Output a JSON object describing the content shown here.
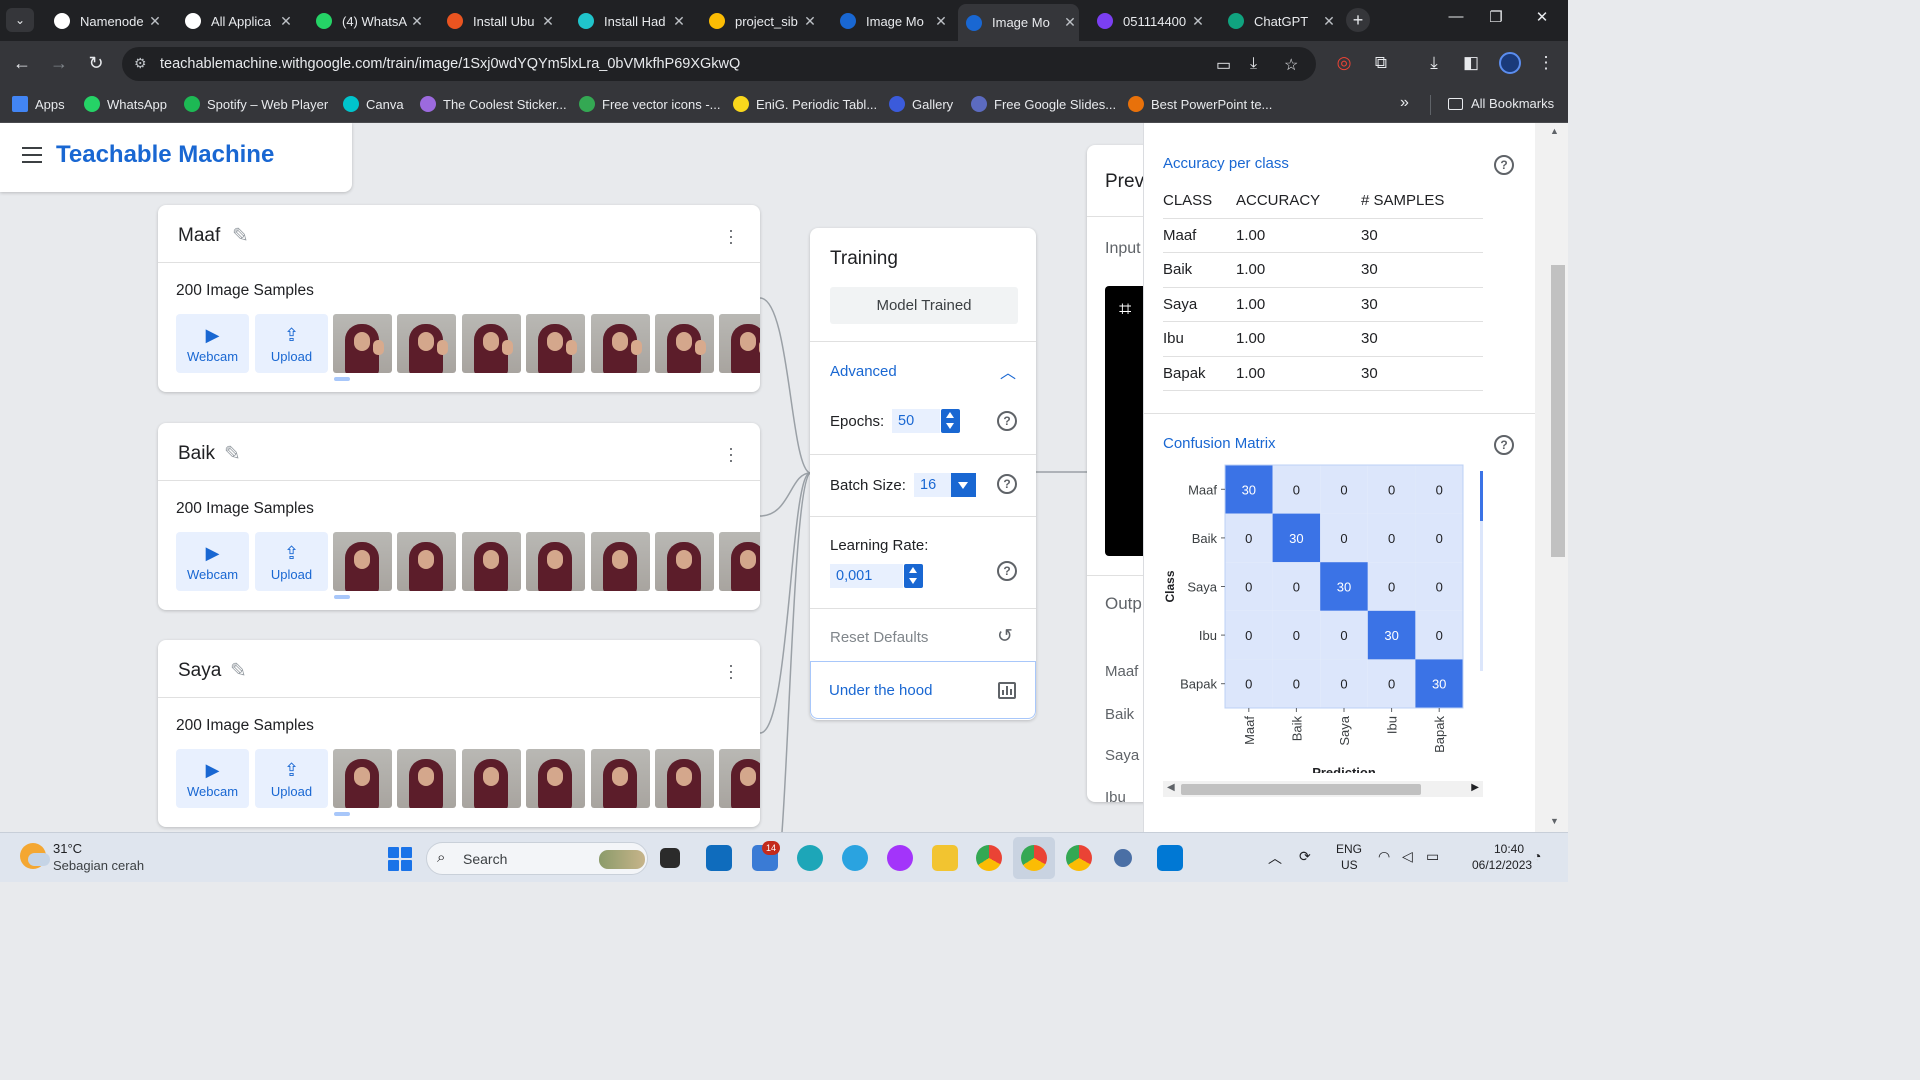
{
  "browser": {
    "tabs": [
      {
        "title": "Namenode",
        "favicon_color": "#ffffff",
        "favicon": "globe-icon"
      },
      {
        "title": "All Applica",
        "favicon_color": "#ffffff",
        "favicon": "globe-icon"
      },
      {
        "title": "(4) WhatsA",
        "favicon_color": "#25d366",
        "favicon": "whatsapp-icon"
      },
      {
        "title": "Install Ubu",
        "favicon_color": "#e95420",
        "favicon": "ubuntu-icon"
      },
      {
        "title": "Install Had",
        "favicon_color": "#20c4cb",
        "favicon": "k-icon"
      },
      {
        "title": "project_sib",
        "favicon_color": "#fbbc04",
        "favicon": "drive-icon"
      },
      {
        "title": "Image Mo",
        "favicon_color": "#1967d2",
        "favicon": "tm-icon"
      },
      {
        "title": "Image Mo",
        "favicon_color": "#1967d2",
        "favicon": "tm-icon",
        "active": true
      },
      {
        "title": "051114400",
        "favicon_color": "#7b3ff2",
        "favicon": "app-icon"
      },
      {
        "title": "ChatGPT",
        "favicon_color": "#10a37f",
        "favicon": "chatgpt-icon"
      }
    ],
    "url": "teachablemachine.withgoogle.com/train/image/1Sxj0wdYQYm5lxLra_0bVMkfhP69XGkwQ",
    "bookmarks": [
      {
        "label": "Apps",
        "color": "#4285f4"
      },
      {
        "label": "WhatsApp",
        "color": "#25d366"
      },
      {
        "label": "Spotify – Web Player",
        "color": "#1db954"
      },
      {
        "label": "Canva",
        "color": "#00c4cc"
      },
      {
        "label": "The Coolest Sticker...",
        "color": "#9c6ade"
      },
      {
        "label": "Free vector icons -...",
        "color": "#34a853"
      },
      {
        "label": "EniG. Periodic Tabl...",
        "color": "#f9d71c"
      },
      {
        "label": "Gallery",
        "color": "#3b5bdb"
      },
      {
        "label": "Free Google Slides...",
        "color": "#5c6bc0"
      },
      {
        "label": "Best PowerPoint te...",
        "color": "#e8710a"
      }
    ],
    "all_bookmarks": "All Bookmarks"
  },
  "app": {
    "title": "Teachable Machine",
    "accent": "#1967d2"
  },
  "classes": [
    {
      "name": "Maaf",
      "samples_label": "200 Image Samples",
      "webcam": "Webcam",
      "upload": "Upload"
    },
    {
      "name": "Baik",
      "samples_label": "200 Image Samples",
      "webcam": "Webcam",
      "upload": "Upload"
    },
    {
      "name": "Saya",
      "samples_label": "200 Image Samples",
      "webcam": "Webcam",
      "upload": "Upload"
    }
  ],
  "training": {
    "title": "Training",
    "status_button": "Model Trained",
    "advanced": "Advanced",
    "epochs_label": "Epochs:",
    "epochs_value": "50",
    "batch_label": "Batch Size:",
    "batch_value": "16",
    "lr_label": "Learning Rate:",
    "lr_value": "0,001",
    "reset": "Reset Defaults",
    "under_hood": "Under the hood"
  },
  "preview": {
    "title": "Prev",
    "input": "Input",
    "output": "Outp",
    "output_classes": [
      "Maaf",
      "Baik",
      "Saya",
      "Ibu"
    ]
  },
  "under_hood": {
    "accuracy_title": "Accuracy per class",
    "columns": [
      "CLASS",
      "ACCURACY",
      "# SAMPLES"
    ],
    "rows": [
      {
        "class": "Maaf",
        "accuracy": "1.00",
        "samples": "30"
      },
      {
        "class": "Baik",
        "accuracy": "1.00",
        "samples": "30"
      },
      {
        "class": "Saya",
        "accuracy": "1.00",
        "samples": "30"
      },
      {
        "class": "Ibu",
        "accuracy": "1.00",
        "samples": "30"
      },
      {
        "class": "Bapak",
        "accuracy": "1.00",
        "samples": "30"
      }
    ],
    "confusion_title": "Confusion Matrix"
  },
  "chart_data": {
    "type": "heatmap",
    "title": "",
    "xlabel": "Prediction",
    "ylabel": "Class",
    "x_categories": [
      "Maaf",
      "Baik",
      "Saya",
      "Ibu",
      "Bapak"
    ],
    "y_categories": [
      "Maaf",
      "Baik",
      "Saya",
      "Ibu",
      "Bapak"
    ],
    "values": [
      [
        30,
        0,
        0,
        0,
        0
      ],
      [
        0,
        30,
        0,
        0,
        0
      ],
      [
        0,
        0,
        30,
        0,
        0
      ],
      [
        0,
        0,
        0,
        30,
        0
      ],
      [
        0,
        0,
        0,
        0,
        30
      ]
    ],
    "colors": {
      "high": "#3b73e6",
      "low": "#dce6fb"
    }
  },
  "taskbar": {
    "temperature": "31°C",
    "weather": "Sebagian cerah",
    "search": "Search",
    "badge": "14",
    "lang_top": "ENG",
    "lang_bottom": "US",
    "time": "10:40",
    "date": "06/12/2023"
  }
}
